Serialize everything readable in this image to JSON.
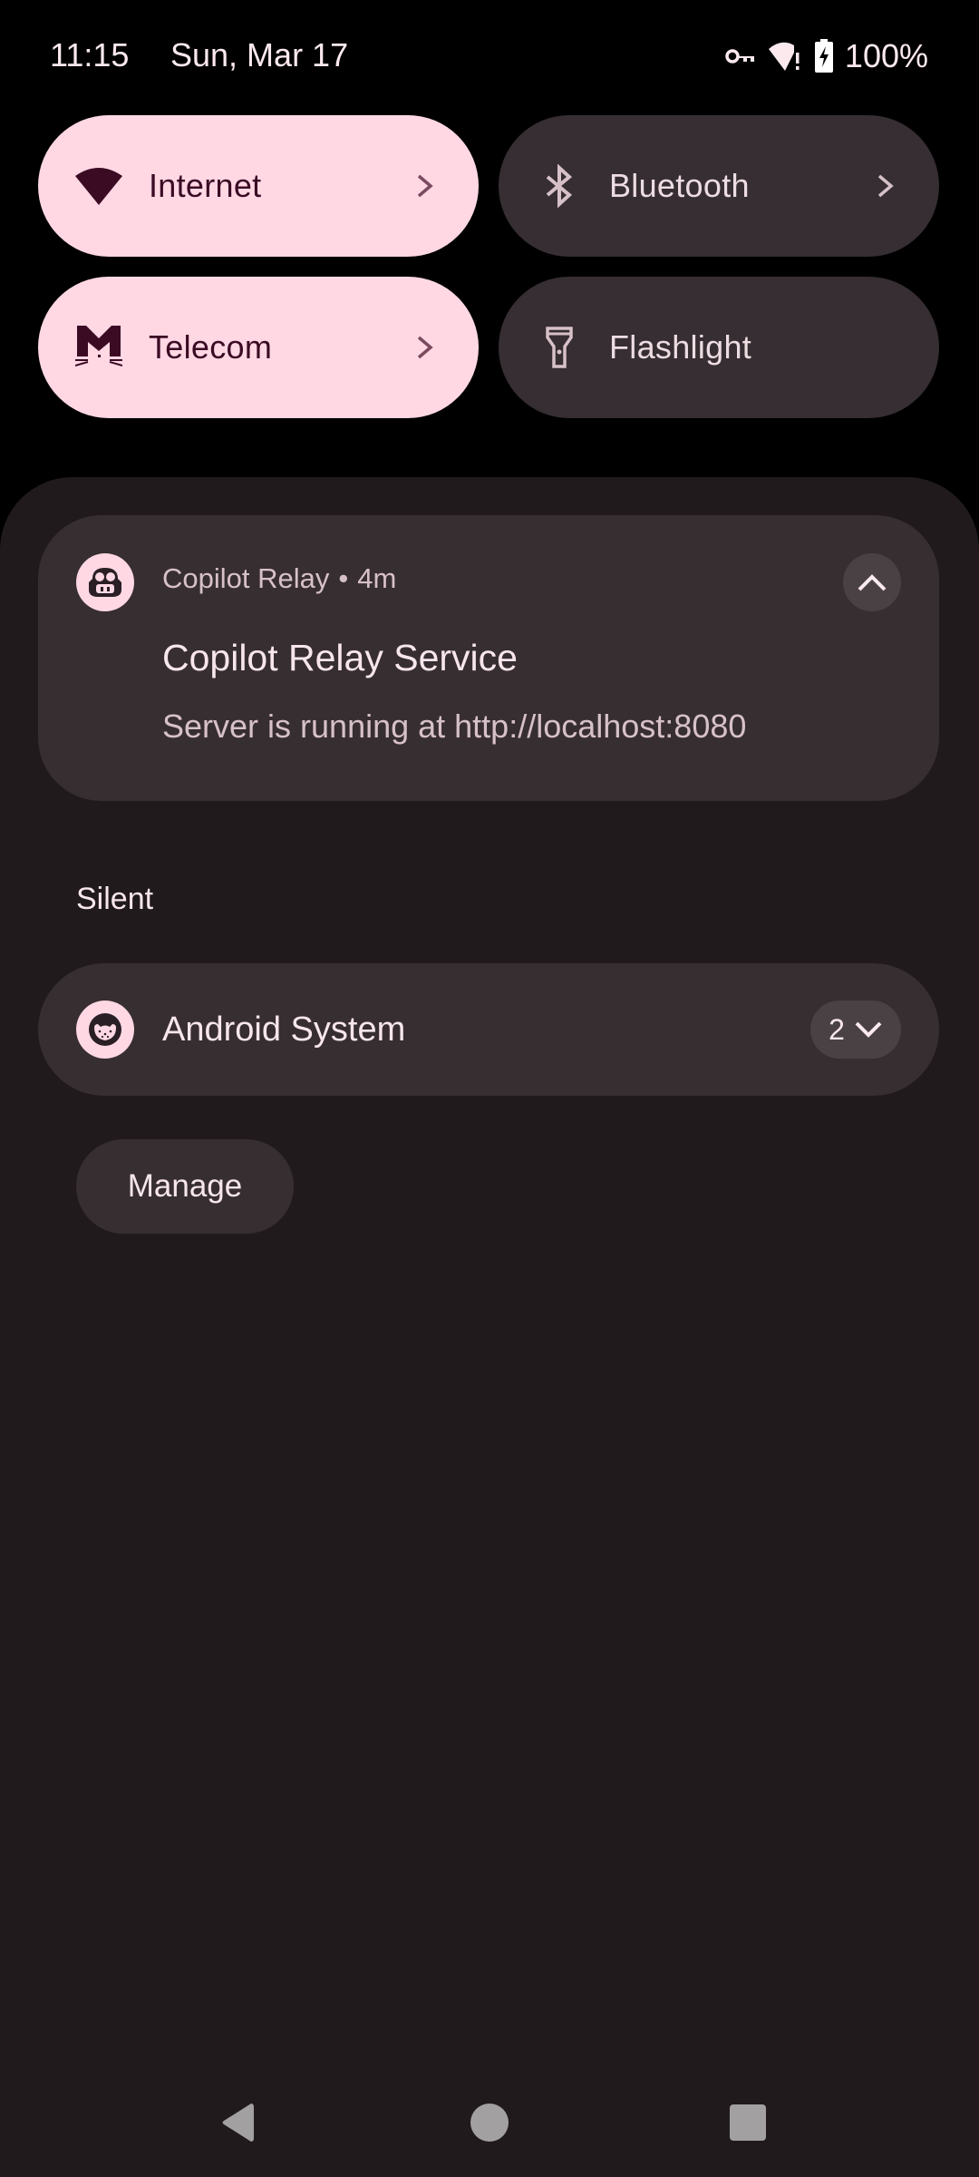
{
  "status_bar": {
    "time": "11:15",
    "date": "Sun, Mar 17",
    "icons": [
      "vpn-key-icon",
      "wifi-alert-icon",
      "battery-charging-icon"
    ],
    "battery_text": "100%"
  },
  "quick_settings": {
    "tiles": [
      {
        "label": "Internet",
        "icon": "wifi-icon",
        "state": "on",
        "has_chevron": true
      },
      {
        "label": "Bluetooth",
        "icon": "bluetooth-icon",
        "state": "off",
        "has_chevron": true
      },
      {
        "label": "Telecom",
        "icon": "cat-telecom-icon",
        "state": "on",
        "has_chevron": true
      },
      {
        "label": "Flashlight",
        "icon": "flashlight-icon",
        "state": "off",
        "has_chevron": false
      }
    ]
  },
  "notifications": {
    "ongoing": {
      "app_name": "Copilot Relay",
      "separator": "•",
      "time_ago": "4m",
      "title": "Copilot Relay Service",
      "body": "Server is running at http://localhost:8080",
      "icon": "copilot-icon",
      "expanded": true
    },
    "silent_section_label": "Silent",
    "silent_group": {
      "title": "Android System",
      "count": "2",
      "icon": "android-system-icon"
    },
    "manage_label": "Manage"
  },
  "nav_bar": {
    "buttons": [
      "back",
      "home",
      "recents"
    ]
  },
  "colors": {
    "tile_on_bg": "#ffd8e4",
    "tile_on_fg": "#3b0b24",
    "tile_off_bg": "#362e32",
    "panel_bg": "#211a1d",
    "card_bg": "#372e32"
  }
}
